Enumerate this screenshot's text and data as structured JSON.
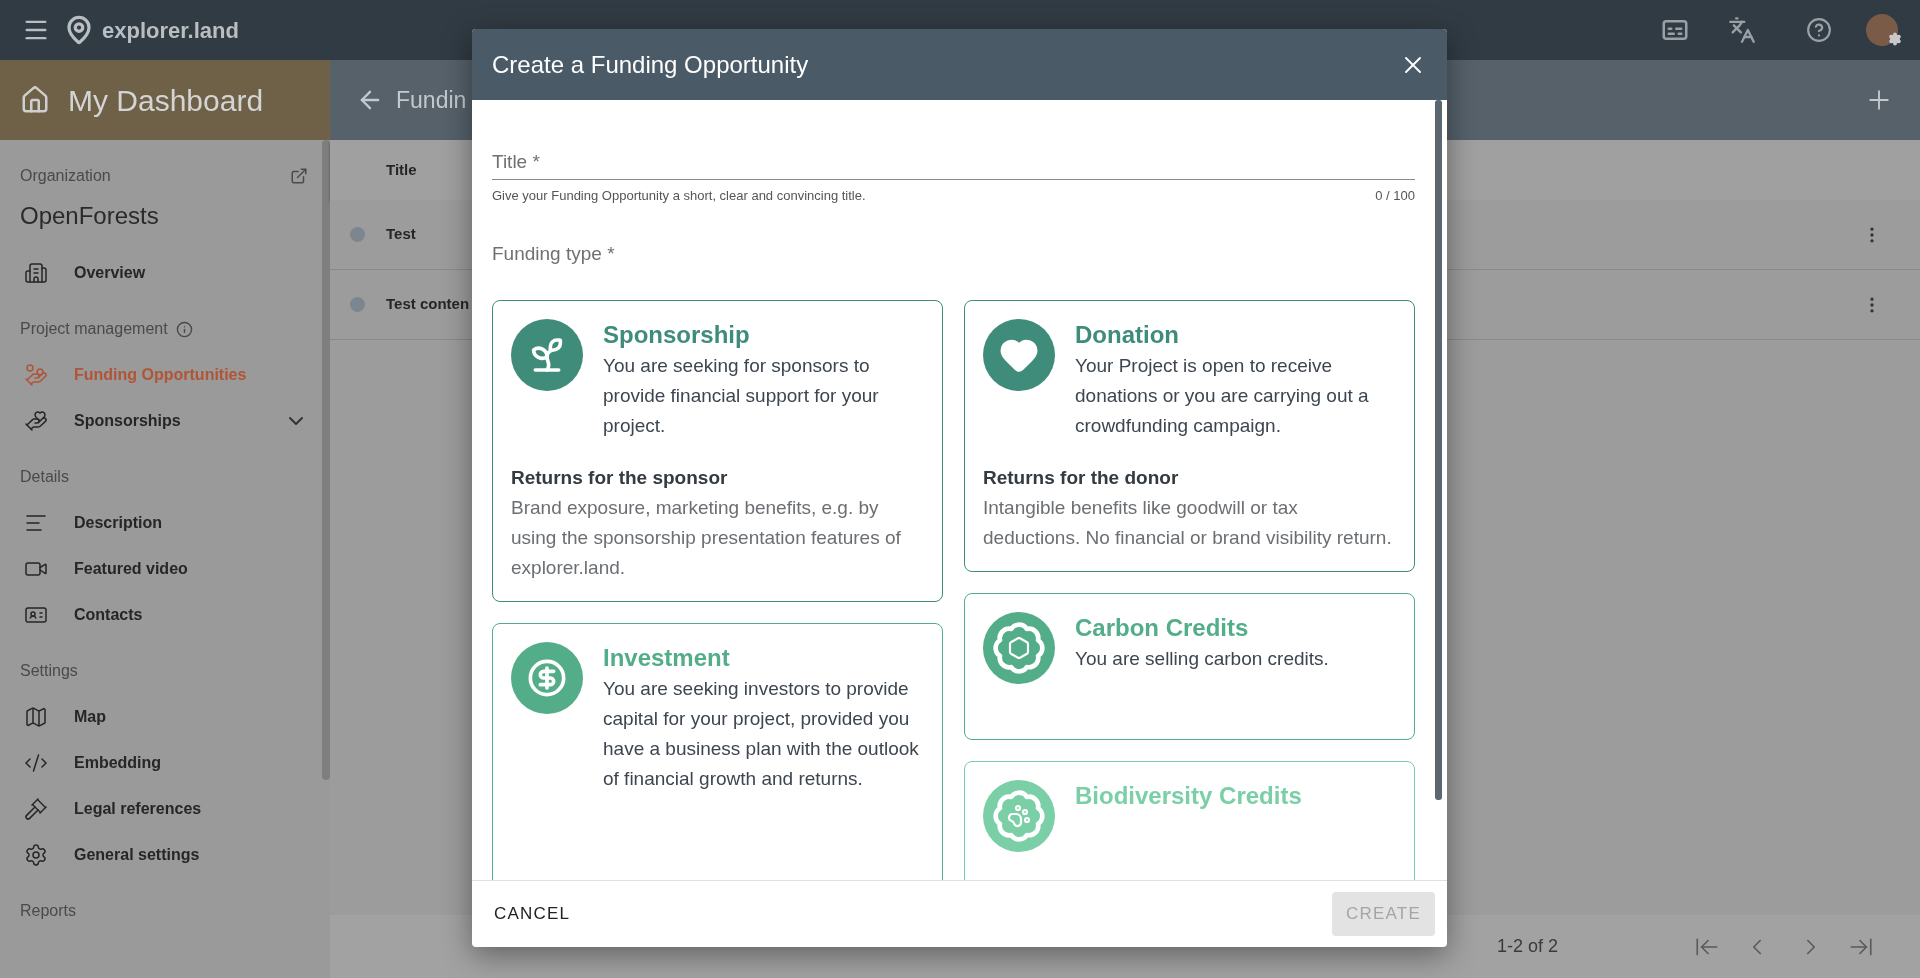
{
  "app_bar": {
    "logo_text": "explorer.land"
  },
  "sidebar": {
    "header": "My Dashboard",
    "organization_label": "Organization",
    "organization_name": "OpenForests",
    "groups": [
      {
        "items": [
          {
            "label": "Overview",
            "selected": false
          }
        ]
      },
      {
        "heading": "Project management",
        "has_info": true,
        "items": [
          {
            "label": "Funding Opportunities",
            "selected": true
          },
          {
            "label": "Sponsorships",
            "selected": false,
            "expanded": false
          }
        ]
      },
      {
        "heading": "Details",
        "items": [
          {
            "label": "Description",
            "selected": false
          },
          {
            "label": "Featured video",
            "selected": false
          },
          {
            "label": "Contacts",
            "selected": false
          }
        ]
      },
      {
        "heading": "Settings",
        "items": [
          {
            "label": "Map",
            "selected": false
          },
          {
            "label": "Embedding",
            "selected": false
          },
          {
            "label": "Legal references",
            "selected": false
          },
          {
            "label": "General settings",
            "selected": false
          }
        ]
      },
      {
        "heading": "Reports"
      }
    ]
  },
  "page": {
    "back_title": "Fundin",
    "table": {
      "columns": [
        "Title"
      ],
      "rows": [
        {
          "title": "Test",
          "color": "#7b8690"
        },
        {
          "title": "Test conten",
          "color": "#7b8690"
        }
      ]
    },
    "pagination": {
      "range": "1-2 of 2"
    }
  },
  "dialog": {
    "title": "Create a Funding Opportunity",
    "title_field": {
      "placeholder": "Title *",
      "hint": "Give your Funding Opportunity a short, clear and convincing title.",
      "counter": "0 / 100"
    },
    "funding_type_label": "Funding type *",
    "options": [
      {
        "name": "Sponsorship",
        "description": "You are seeking for sponsors to provide financial support for your project.",
        "returns_heading": "Returns for the sponsor",
        "returns_text": "Brand exposure, marketing benefits, e.g. by using the sponsorship presentation features of explorer.land.",
        "color": "#3e8c79",
        "selected": false
      },
      {
        "name": "Donation",
        "description": "Your Project is open to receive donations or you are carrying out a crowdfunding campaign.",
        "returns_heading": "Returns for the donor",
        "returns_text": "Intangible benefits like goodwill or tax deductions. No financial or brand visibility return.",
        "color": "#3e8c79",
        "selected": false
      },
      {
        "name": "Investment",
        "description": "You are seeking investors to provide capital for your project, provided you have a business plan with the outlook of financial growth and returns.",
        "color": "#52ad88",
        "selected": false
      },
      {
        "name": "Carbon Credits",
        "description": "You are selling carbon credits.",
        "color": "#52ad88",
        "selected": false
      },
      {
        "name": "Biodiversity Credits",
        "color": "#7acfa6",
        "selected": false
      }
    ],
    "buttons": {
      "cancel": "CANCEL",
      "create": "CREATE",
      "create_disabled": true
    }
  }
}
